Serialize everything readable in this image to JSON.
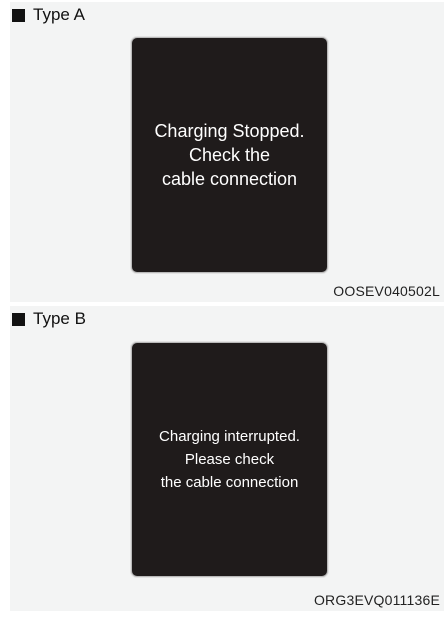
{
  "figures": [
    {
      "label": "Type A",
      "message_lines": [
        "Charging Stopped.",
        "Check the",
        "cable connection"
      ],
      "code": "OOSEV040502L"
    },
    {
      "label": "Type B",
      "message_lines": [
        "Charging interrupted.",
        "Please check",
        "the cable connection"
      ],
      "code": "ORG3EVQ011136E"
    }
  ],
  "colors": {
    "panel_background": "#f3f4f4",
    "screen_background": "#1f1b1b",
    "screen_text": "#ffffff"
  },
  "icons": {
    "heading_marker": "filled-square-icon"
  }
}
